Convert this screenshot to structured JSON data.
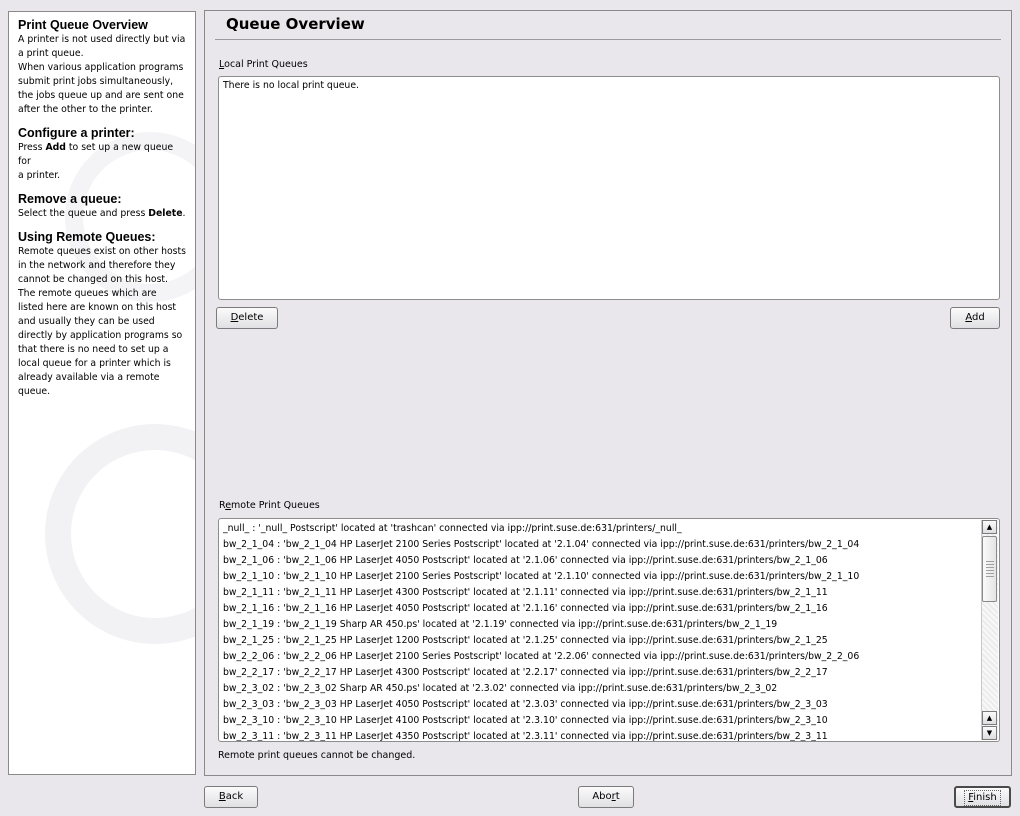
{
  "help": {
    "sections": [
      {
        "title": "Print Queue Overview",
        "lines": [
          "A printer is not used directly but via",
          "a print queue.",
          "When various application programs",
          "submit print jobs simultaneously,",
          "the jobs queue up and are sent one",
          "after the other to the printer."
        ]
      },
      {
        "title": "Configure a printer:",
        "pre": "Press ",
        "bold": "Add",
        "post": " to set up a new queue for",
        "line2": "a printer."
      },
      {
        "title": "Remove a queue:",
        "pre": "Select the queue and press ",
        "bold": "Delete",
        "post": "."
      },
      {
        "title": "Using Remote Queues:",
        "lines": [
          "Remote queues exist on other hosts",
          "in the network and therefore they",
          "cannot be changed on this host.",
          "The remote queues which are",
          "listed here are known on this host",
          "and usually they can be used",
          "directly by application programs so",
          "that there is no need to set up a",
          "local queue for a printer which is",
          "already available via a remote",
          "queue."
        ]
      }
    ]
  },
  "main": {
    "title": "Queue Overview",
    "local": {
      "label_ul": "L",
      "label_rest": "ocal Print Queues",
      "empty_text": "There is no local print queue."
    },
    "delete_label": {
      "ul": "D",
      "rest": "elete"
    },
    "add_label": {
      "ul": "A",
      "rest": "dd"
    },
    "remote": {
      "label_pre": "R",
      "label_ul": "e",
      "label_rest": "mote Print Queues",
      "rows": [
        "_null_ : '_null_ Postscript' located at 'trashcan' connected via ipp://print.suse.de:631/printers/_null_",
        "bw_2_1_04 : 'bw_2_1_04 HP LaserJet 2100 Series Postscript' located at '2.1.04' connected via ipp://print.suse.de:631/printers/bw_2_1_04",
        "bw_2_1_06 : 'bw_2_1_06 HP LaserJet 4050 Postscript' located at '2.1.06' connected via ipp://print.suse.de:631/printers/bw_2_1_06",
        "bw_2_1_10 : 'bw_2_1_10 HP LaserJet 2100 Series Postscript' located at '2.1.10' connected via ipp://print.suse.de:631/printers/bw_2_1_10",
        "bw_2_1_11 : 'bw_2_1_11 HP LaserJet 4300 Postscript' located at '2.1.11' connected via ipp://print.suse.de:631/printers/bw_2_1_11",
        "bw_2_1_16 : 'bw_2_1_16 HP LaserJet 4050 Postscript' located at '2.1.16' connected via ipp://print.suse.de:631/printers/bw_2_1_16",
        "bw_2_1_19 : 'bw_2_1_19 Sharp AR 450.ps' located at '2.1.19' connected via ipp://print.suse.de:631/printers/bw_2_1_19",
        "bw_2_1_25 : 'bw_2_1_25 HP LaserJet 1200 Postscript' located at '2.1.25' connected via ipp://print.suse.de:631/printers/bw_2_1_25",
        "bw_2_2_06 : 'bw_2_2_06 HP LaserJet 2100 Series Postscript' located at '2.2.06' connected via ipp://print.suse.de:631/printers/bw_2_2_06",
        "bw_2_2_17 : 'bw_2_2_17 HP LaserJet 4300 Postscript' located at '2.2.17' connected via ipp://print.suse.de:631/printers/bw_2_2_17",
        "bw_2_3_02 : 'bw_2_3_02 Sharp AR 450.ps' located at '2.3.02' connected via ipp://print.suse.de:631/printers/bw_2_3_02",
        "bw_2_3_03 : 'bw_2_3_03 HP LaserJet 4050 Postscript' located at '2.3.03' connected via ipp://print.suse.de:631/printers/bw_2_3_03",
        "bw_2_3_10 : 'bw_2_3_10 HP LaserJet 4100 Postscript' located at '2.3.10' connected via ipp://print.suse.de:631/printers/bw_2_3_10",
        "bw_2_3_11 : 'bw_2_3_11 HP LaserJet 4350 Postscript' located at '2.3.11' connected via ipp://print.suse.de:631/printers/bw_2_3_11"
      ],
      "note": "Remote print queues cannot be changed."
    }
  },
  "footer": {
    "back": {
      "ul": "B",
      "rest": "ack"
    },
    "abort": {
      "pre": "Abo",
      "ul": "r",
      "rest": "t"
    },
    "finish": {
      "ul": "F",
      "rest": "inish"
    }
  },
  "icons": {
    "scroll_up": "arrow-up-icon",
    "scroll_down": "arrow-down-icon"
  }
}
